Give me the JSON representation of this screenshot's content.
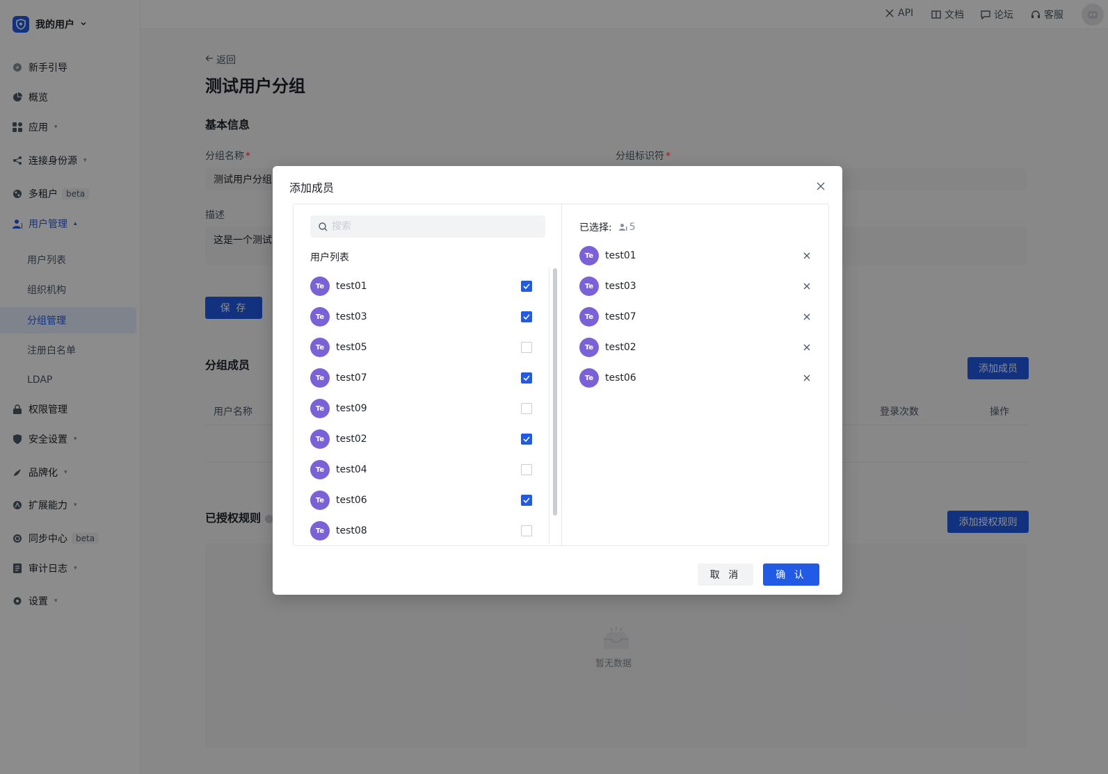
{
  "app": {
    "brand_title": "我的用户"
  },
  "sidebar": {
    "items": [
      {
        "label": "新手引导"
      },
      {
        "label": "概览"
      },
      {
        "label": "应用"
      },
      {
        "label": "连接身份源"
      },
      {
        "label": "多租户",
        "badge": "beta"
      },
      {
        "label": "用户管理"
      },
      {
        "label": "权限管理"
      },
      {
        "label": "安全设置"
      },
      {
        "label": "品牌化"
      },
      {
        "label": "扩展能力"
      },
      {
        "label": "同步中心",
        "badge": "beta"
      },
      {
        "label": "审计日志"
      },
      {
        "label": "设置"
      }
    ],
    "sub_items": [
      {
        "label": "用户列表"
      },
      {
        "label": "组织机构"
      },
      {
        "label": "分组管理"
      },
      {
        "label": "注册白名单"
      },
      {
        "label": "LDAP"
      }
    ]
  },
  "topbar": {
    "links": [
      {
        "label": "API",
        "icon": "tools-icon"
      },
      {
        "label": "文档",
        "icon": "book-icon"
      },
      {
        "label": "论坛",
        "icon": "message-icon"
      },
      {
        "label": "客服",
        "icon": "headset-icon"
      }
    ]
  },
  "main": {
    "back_label": "返回",
    "page_title": "测试用户分组",
    "basic_info_title": "基本信息",
    "group_name_label": "分组名称",
    "group_name_value": "测试用户分组",
    "group_id_label": "分组标识符",
    "desc_label": "描述",
    "desc_value": "这是一个测试",
    "save_label": "保 存",
    "members_title": "分组成员",
    "add_member_label": "添加成员",
    "table_headers": {
      "username": "用户名称",
      "login_count": "登录次数",
      "actions": "操作"
    },
    "auth_rules_title": "已授权规则",
    "add_rule_label": "添加授权规则",
    "empty_text": "暂无数据"
  },
  "modal": {
    "title": "添加成员",
    "search_placeholder": "搜索",
    "list_title": "用户列表",
    "users": [
      {
        "avatar": "Te",
        "name": "test01",
        "checked": true
      },
      {
        "avatar": "Te",
        "name": "test03",
        "checked": true
      },
      {
        "avatar": "Te",
        "name": "test05",
        "checked": false
      },
      {
        "avatar": "Te",
        "name": "test07",
        "checked": true
      },
      {
        "avatar": "Te",
        "name": "test09",
        "checked": false
      },
      {
        "avatar": "Te",
        "name": "test02",
        "checked": true
      },
      {
        "avatar": "Te",
        "name": "test04",
        "checked": false
      },
      {
        "avatar": "Te",
        "name": "test06",
        "checked": true
      },
      {
        "avatar": "Te",
        "name": "test08",
        "checked": false
      }
    ],
    "selected_title": "已选择:",
    "selected_count": "5",
    "selected": [
      {
        "avatar": "Te",
        "name": "test01"
      },
      {
        "avatar": "Te",
        "name": "test03"
      },
      {
        "avatar": "Te",
        "name": "test07"
      },
      {
        "avatar": "Te",
        "name": "test02"
      },
      {
        "avatar": "Te",
        "name": "test06"
      }
    ],
    "cancel_label": "取 消",
    "confirm_label": "确 认"
  },
  "colors": {
    "primary": "#215ae5",
    "avatar": "#7b61d8",
    "danger": "#f53f3f"
  }
}
